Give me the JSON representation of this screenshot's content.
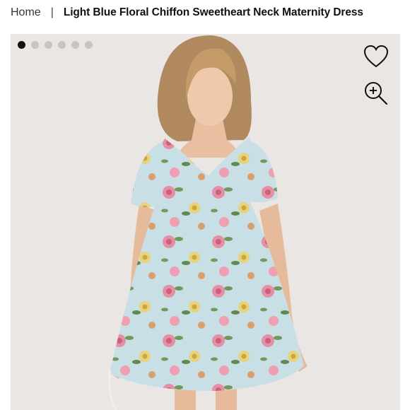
{
  "breadcrumb": {
    "home": "Home",
    "separator": "|",
    "current": "Light Blue Floral Chiffon Sweetheart Neck Maternity Dress"
  },
  "gallery": {
    "image_count": 6,
    "active_index": 0,
    "image_alt": "Model wearing light blue floral chiffon maternity dress"
  },
  "icons": {
    "favorite": "heart-icon",
    "zoom": "zoom-in-icon"
  },
  "colors": {
    "background": "#eae6e4",
    "dress": "#c9dfe6",
    "dot_active": "#111111",
    "dot_inactive": "#c8c4c2"
  }
}
